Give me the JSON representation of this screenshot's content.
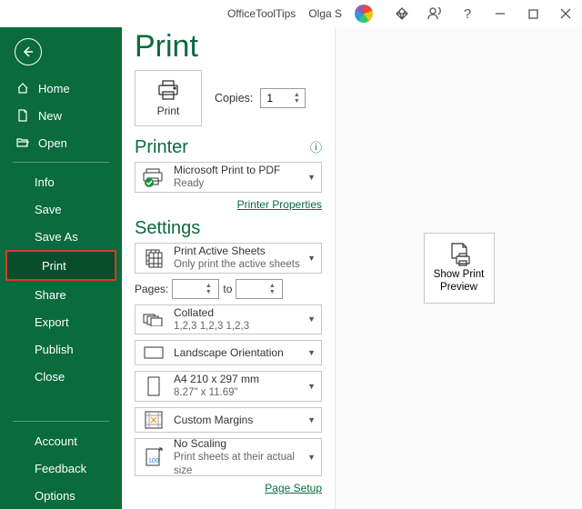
{
  "titlebar": {
    "app": "OfficeToolTips",
    "user": "Olga S"
  },
  "sidebar": {
    "top": [
      {
        "label": "Home"
      },
      {
        "label": "New"
      },
      {
        "label": "Open"
      }
    ],
    "mid": [
      {
        "label": "Info"
      },
      {
        "label": "Save"
      },
      {
        "label": "Save As"
      },
      {
        "label": "Print",
        "active": true
      },
      {
        "label": "Share"
      },
      {
        "label": "Export"
      },
      {
        "label": "Publish"
      },
      {
        "label": "Close"
      }
    ],
    "bottom": [
      {
        "label": "Account"
      },
      {
        "label": "Feedback"
      },
      {
        "label": "Options"
      }
    ]
  },
  "print": {
    "title": "Print",
    "button": "Print",
    "copies_label": "Copies:",
    "copies_value": "1"
  },
  "printer": {
    "heading": "Printer",
    "name": "Microsoft Print to PDF",
    "status": "Ready",
    "properties": "Printer Properties"
  },
  "settings": {
    "heading": "Settings",
    "scope": {
      "title": "Print Active Sheets",
      "subtitle": "Only print the active sheets"
    },
    "pages_label": "Pages:",
    "pages_to": "to",
    "collate": {
      "title": "Collated",
      "subtitle": "1,2,3    1,2,3    1,2,3"
    },
    "orientation": "Landscape Orientation",
    "paper": {
      "title": "A4 210 x 297 mm",
      "subtitle": "8.27\" x 11.69\""
    },
    "margins": "Custom Margins",
    "scaling": {
      "title": "No Scaling",
      "subtitle": "Print sheets at their actual size"
    },
    "page_setup": "Page Setup"
  },
  "preview": {
    "button_l1": "Show Print",
    "button_l2": "Preview"
  }
}
